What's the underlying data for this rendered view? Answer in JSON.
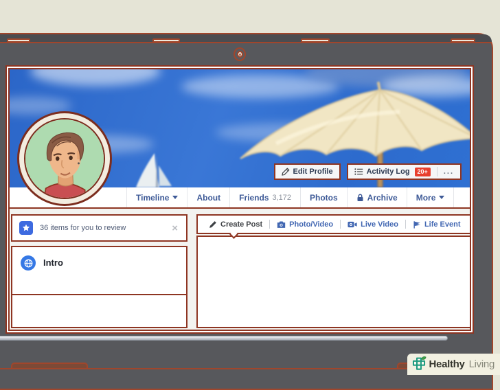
{
  "brand": {
    "bold": "Healthy",
    "light": "Living"
  },
  "cover": {
    "edit_profile": "Edit Profile",
    "activity_log": "Activity Log",
    "activity_badge": "20+",
    "more_options": "..."
  },
  "nav": {
    "items": [
      {
        "label": "Timeline",
        "caret": true
      },
      {
        "label": "About"
      },
      {
        "label": "Friends",
        "count": "3,172"
      },
      {
        "label": "Photos"
      },
      {
        "label": "Archive",
        "icon": "lock"
      },
      {
        "label": "More",
        "caret": true
      }
    ]
  },
  "sidebar": {
    "review": {
      "text": "36 items for you to review",
      "close": "×",
      "icon": "star"
    },
    "intro": {
      "label": "Intro",
      "icon": "globe"
    }
  },
  "composer": {
    "tabs": [
      {
        "label": "Create Post",
        "icon": "pencil",
        "active": true
      },
      {
        "label": "Photo/Video",
        "icon": "camera"
      },
      {
        "label": "Live Video",
        "icon": "video-camera"
      },
      {
        "label": "Life Event",
        "icon": "flag"
      }
    ]
  },
  "colors": {
    "background_beige": "#e5e4d6",
    "laptop_gray": "#57585c",
    "outline_red": "#8e3522",
    "facebook_blue": "#3e5a97",
    "badge_red": "#e83f2e",
    "star_tile_blue": "#3d6ae0",
    "globe_blue": "#3578e5",
    "cover_sky_blue": "#2d6bcd",
    "brand_green": "#1d9a7f"
  }
}
